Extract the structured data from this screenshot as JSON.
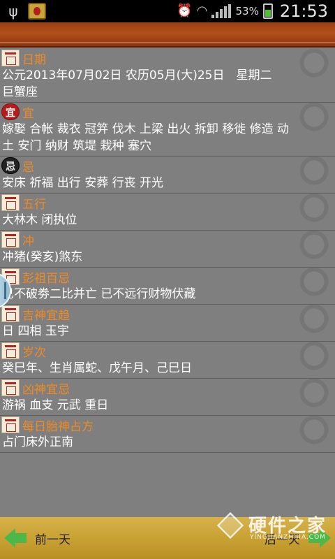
{
  "status_bar": {
    "battery_percent": "53%",
    "time": "21:53",
    "icons": [
      "usb-icon",
      "app-notification-icon",
      "alarm-icon",
      "wifi-icon",
      "signal-icon",
      "battery-charging-icon"
    ]
  },
  "sections": [
    {
      "title": "日期",
      "icon": "calendar-icon",
      "body": "公元2013年07月02日 农历05月(大)25日　星期二　巨蟹座"
    },
    {
      "title": "宜",
      "icon": "yi-icon",
      "icon_char": "宜",
      "body": "嫁娶 合帐 裁衣 冠笄 伐木 上梁 出火 拆卸 移徙 修造 动土 安门 纳财 筑堤 栽种 塞穴"
    },
    {
      "title": "忌",
      "icon": "ji-icon",
      "icon_char": "忌",
      "body": "安床 祈福 出行 安葬 行丧 开光"
    },
    {
      "title": "五行",
      "icon": "calendar-icon",
      "body": "大林木 闭执位"
    },
    {
      "title": "冲",
      "icon": "calendar-icon",
      "body": "冲猪(癸亥)煞东"
    },
    {
      "title": "彭祖百忌",
      "icon": "calendar-icon",
      "body": "己不破劵二比并亡 已不远行财物伏藏"
    },
    {
      "title": "吉神宜趋",
      "icon": "calendar-icon",
      "body": "日 四相 玉宇"
    },
    {
      "title": "岁次",
      "icon": "calendar-icon",
      "body": "癸巳年、生肖属蛇、戊午月、己巳日"
    },
    {
      "title": "凶神宜忌",
      "icon": "calendar-icon",
      "body": "游祸 血支 元武 重日"
    },
    {
      "title": "每日胎神占方",
      "icon": "calendar-icon",
      "body": "占门床外正南"
    }
  ],
  "bottom_nav": {
    "prev_label": "前一天",
    "next_label": "后一天"
  },
  "watermark": {
    "title": "硬件之家",
    "url": "YINGJIANZHIJIA.COM"
  },
  "colors": {
    "section_title": "#f08a22",
    "body_text": "#ffffff",
    "background": "#7f7f7f",
    "header": "#b1501a",
    "bottom_bar": "#c9a234",
    "arrow": "#4db84a"
  }
}
